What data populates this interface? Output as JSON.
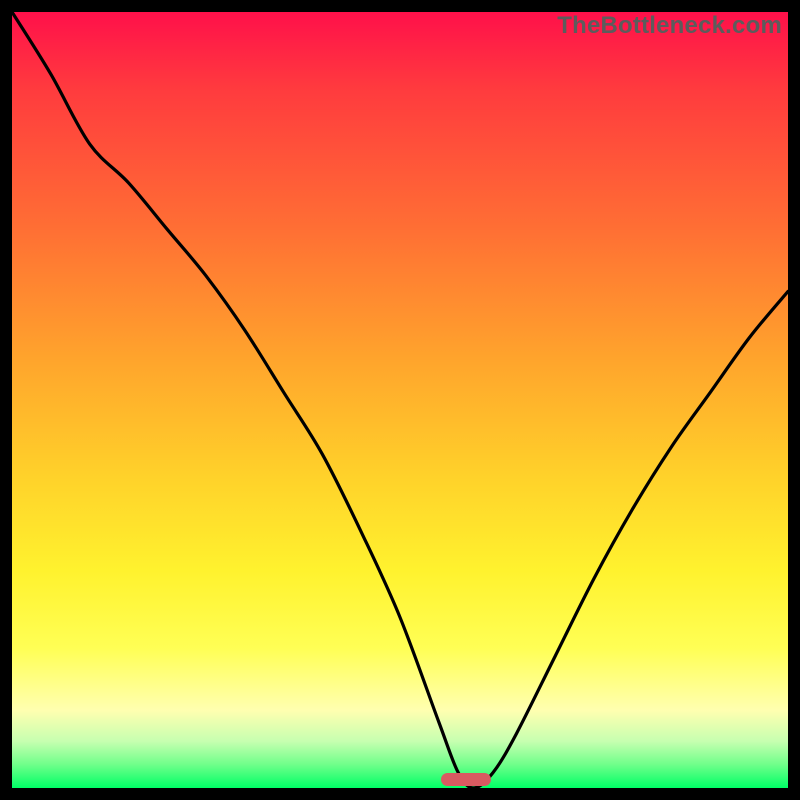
{
  "attribution": "TheBottleneck.com",
  "colors": {
    "frame_border": "#000000",
    "curve_stroke": "#000000",
    "marker_fill": "#d85a61",
    "gradient": [
      "#ff104a",
      "#ff3b3e",
      "#ff6f34",
      "#ffa52c",
      "#ffd22a",
      "#fff22e",
      "#ffff55",
      "#ffffb0",
      "#c6ffb0",
      "#6fff8a",
      "#00ff66"
    ]
  },
  "chart_data": {
    "type": "line",
    "title": "",
    "xlabel": "",
    "ylabel": "",
    "x": [
      0.0,
      0.05,
      0.1,
      0.15,
      0.2,
      0.25,
      0.3,
      0.35,
      0.4,
      0.45,
      0.5,
      0.55,
      0.575,
      0.595,
      0.62,
      0.65,
      0.7,
      0.75,
      0.8,
      0.85,
      0.9,
      0.95,
      1.0
    ],
    "y": [
      1.0,
      0.92,
      0.83,
      0.78,
      0.72,
      0.66,
      0.59,
      0.51,
      0.43,
      0.33,
      0.22,
      0.085,
      0.02,
      0.0,
      0.02,
      0.07,
      0.17,
      0.27,
      0.36,
      0.44,
      0.51,
      0.58,
      0.64
    ],
    "xlim": [
      0,
      1
    ],
    "ylim": [
      0,
      1
    ],
    "annotations": [
      {
        "kind": "marker-pill",
        "x_center": 0.585,
        "y": 0.0,
        "width_frac": 0.065
      }
    ]
  }
}
